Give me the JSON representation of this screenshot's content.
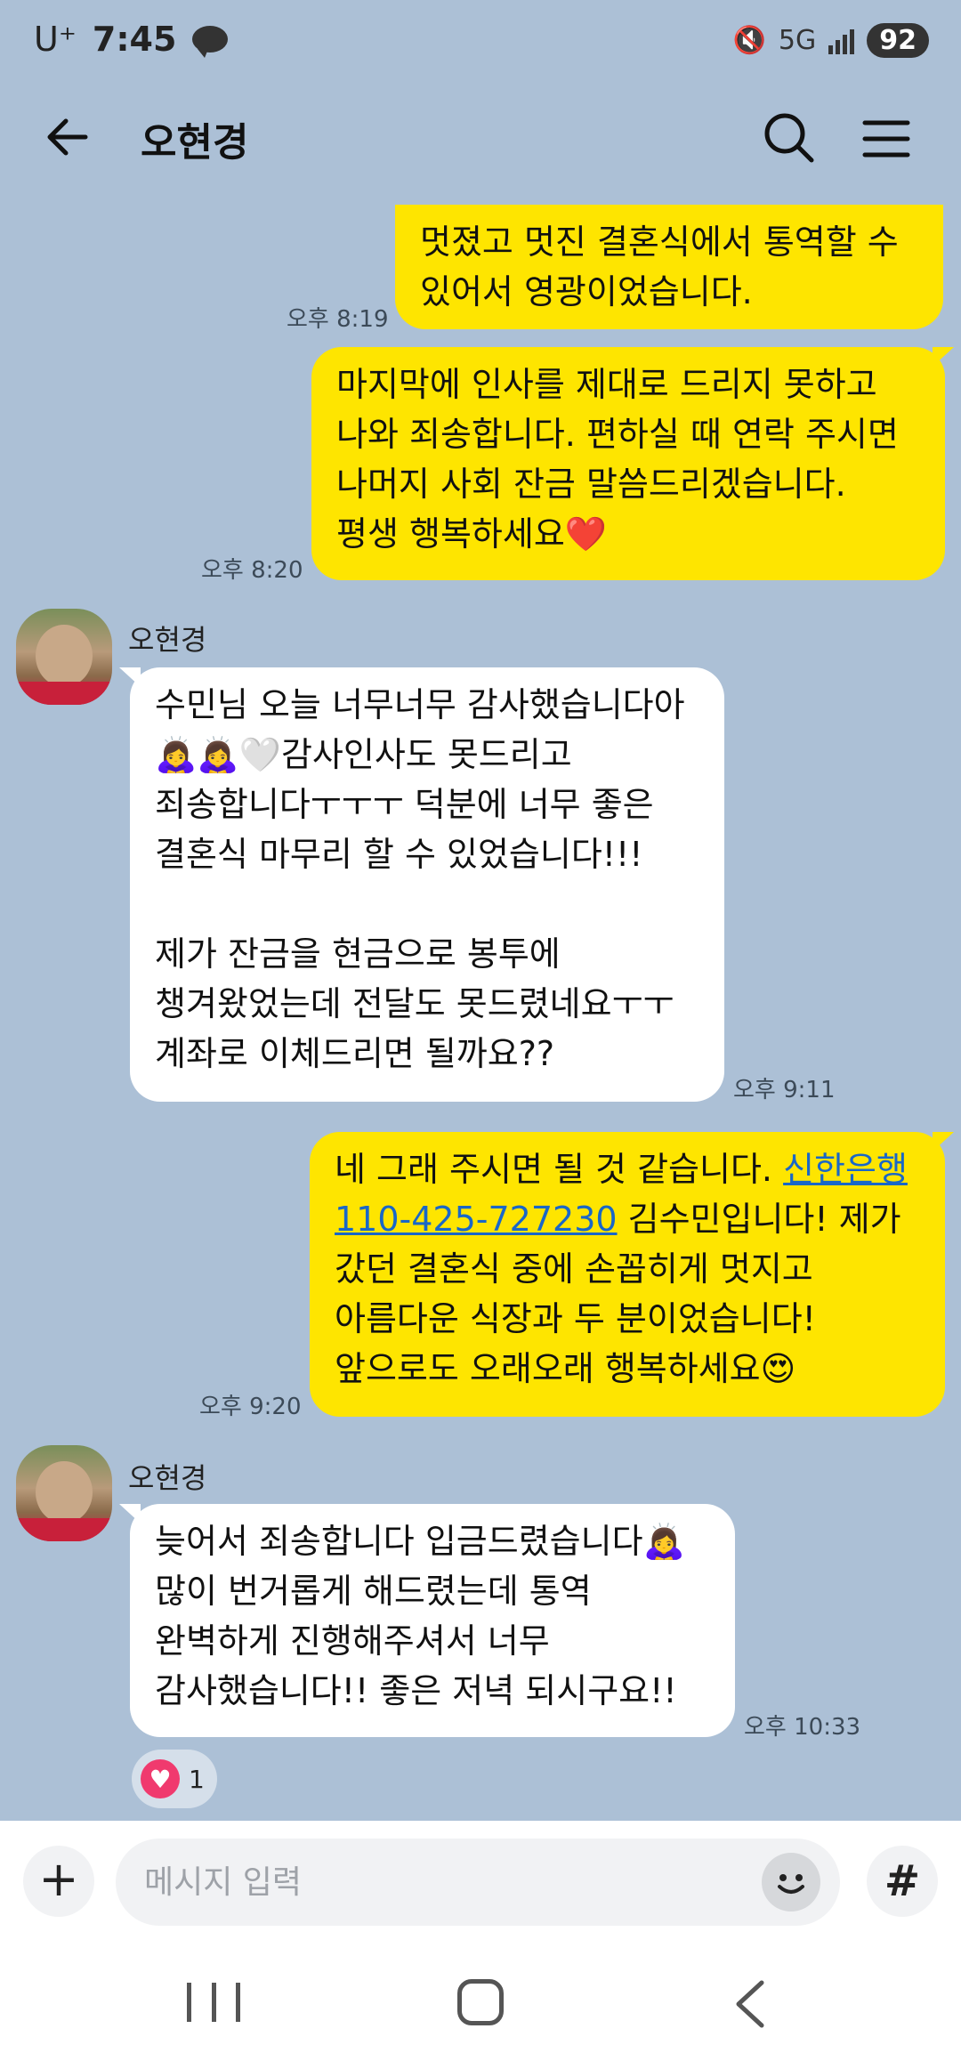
{
  "status_bar": {
    "carrier": "U⁺",
    "time": "7:45",
    "network": "5G",
    "battery": "92"
  },
  "header": {
    "title": "오현경"
  },
  "messages": [
    {
      "id": "m1",
      "sender": "me",
      "time": "오후 8:19",
      "text": "멋졌고 멋진 결혼식에서 통역할 수\n있어서 영광이었습니다."
    },
    {
      "id": "m2",
      "sender": "me",
      "time": "오후 8:20",
      "text": "마지막에 인사를 제대로 드리지 못하고\n나와 죄송합니다. 편하실 때 연락 주시면\n나머지 사회 잔금 말씀드리겠습니다.\n평생 행복하세요❤️"
    },
    {
      "id": "m3",
      "sender": "오현경",
      "time": "오후 9:11",
      "text": "수민님 오늘 너무너무 감사했습니다아\n🙇‍♀️🙇‍♀️🤍감사인사도 못드리고\n죄송합니다ㅜㅜㅜ 덕분에 너무 좋은\n결혼식 마무리 할 수 있었습니다!!!\n\n제가 잔금을 현금으로 봉투에\n챙겨왔었는데 전달도 못드렸네요ㅜㅜ\n계좌로 이체드리면 될까요??"
    },
    {
      "id": "m4",
      "sender": "me",
      "time": "오후 9:20",
      "text_before_link": "네 그래 주시면 될 것 같습니다. ",
      "link_text": "신한은행\n110-425-727230",
      "text_after_link": " 김수민입니다! 제가\n갔던 결혼식 중에 손꼽히게 멋지고\n아름다운 식장과 두 분이었습니다!\n앞으로도 오래오래 행복하세요😍"
    },
    {
      "id": "m5",
      "sender": "오현경",
      "time": "오후 10:33",
      "text": "늦어서 죄송합니다 입금드렸습니다🙇‍♀️\n많이 번거롭게 해드렸는데 통역\n완벽하게 진행해주셔서 너무\n감사했습니다!! 좋은 저녁 되시구요!!",
      "reaction_count": "1"
    }
  ],
  "input": {
    "placeholder": "메시지 입력",
    "hash_label": "#",
    "plus_label": "+"
  },
  "icons": {
    "back": "arrow-left-icon",
    "search": "search-icon",
    "menu": "hamburger-menu-icon",
    "emoji": "smiley-icon",
    "heart": "heart-icon"
  },
  "colors": {
    "background": "#acc0d6",
    "my_bubble": "#fee500",
    "their_bubble": "#ffffff",
    "link": "#1967c8",
    "reaction_heart": "#f03a6e"
  }
}
